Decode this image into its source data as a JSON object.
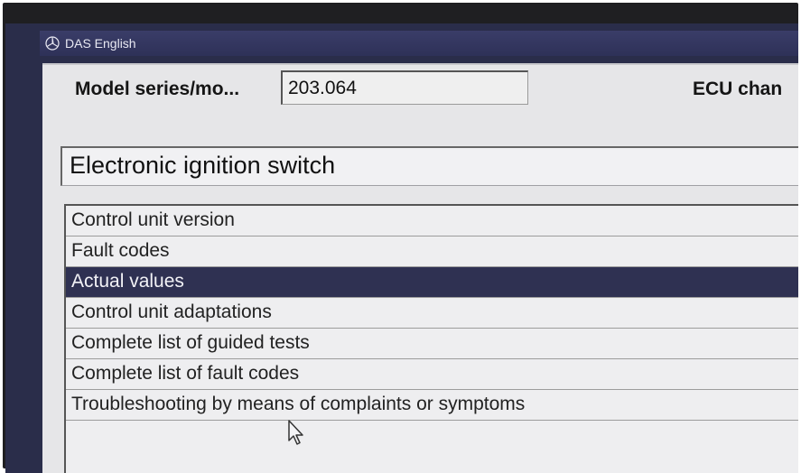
{
  "window": {
    "title": "DAS English",
    "logo_icon": "mercedes-star-icon"
  },
  "model": {
    "label": "Model series/mo...",
    "value": "203.064"
  },
  "ecu": {
    "label": "ECU chan"
  },
  "selected_unit": "Electronic ignition switch",
  "menu": {
    "items": [
      {
        "label": "Control unit version",
        "selected": false
      },
      {
        "label": "Fault codes",
        "selected": false
      },
      {
        "label": "Actual values",
        "selected": true
      },
      {
        "label": "Control unit adaptations",
        "selected": false
      },
      {
        "label": "Complete list of guided tests",
        "selected": false
      },
      {
        "label": "Complete list of fault codes",
        "selected": false
      },
      {
        "label": "Troubleshooting by means of complaints or symptoms",
        "selected": false
      }
    ]
  },
  "colors": {
    "selection": "#2f3152",
    "titlebar": "#2e3158",
    "panel": "#e6e6e8"
  }
}
